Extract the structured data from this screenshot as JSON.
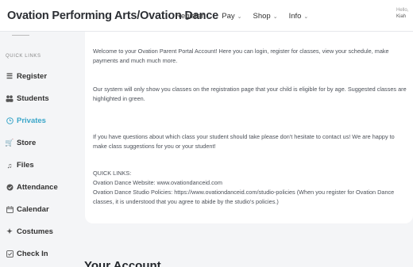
{
  "header": {
    "brand": "Ovation Performing Arts/Ovation Dance",
    "nav": [
      {
        "label": "Register",
        "icon": "chevron-down-icon"
      },
      {
        "label": "Pay",
        "icon": "chevron-down-icon"
      },
      {
        "label": "Shop",
        "icon": "chevron-down-icon"
      },
      {
        "label": "Info",
        "icon": "chevron-down-icon"
      }
    ],
    "user_greeting": "Hello,",
    "user_name": "Kiah"
  },
  "sidebar": {
    "section_label": "QUICK LINKS",
    "items": [
      {
        "label": "Register",
        "icon": "list-icon"
      },
      {
        "label": "Students",
        "icon": "users-icon"
      },
      {
        "label": "Privates",
        "icon": "clock-icon",
        "active": true
      },
      {
        "label": "Store",
        "icon": "cart-icon"
      },
      {
        "label": "Files",
        "icon": "music-icon"
      },
      {
        "label": "Attendance",
        "icon": "check-circle-icon"
      },
      {
        "label": "Calendar",
        "icon": "calendar-icon"
      },
      {
        "label": "Costumes",
        "icon": "person-icon"
      },
      {
        "label": "Check In",
        "icon": "checkbox-icon"
      }
    ]
  },
  "main": {
    "welcome": "Welcome to your Ovation Parent Portal Account! Here you can login, register for classes, view your schedule, make payments and much much more.",
    "system_note": "Our system will only show you classes on the registration page that your child is eligible for by age. Suggested classes are highlighted in green.",
    "questions": "If you have questions about which class your student should take please don't hesitate to contact us! We are happy to make class suggestions for you or your student!",
    "quick_links_title": "QUICK LINKS:",
    "website_line": "Ovation Dance Website: www.ovationdanceid.com",
    "policies_line": "Ovation Dance Studio Policies: https://www.ovationdanceid.com/studio-policies (When you register for Ovation Dance classes, it is understood that you agree to abide by the studio's policies.)",
    "account_heading": "Your Account"
  },
  "colors": {
    "accent": "#3aa6c9",
    "background": "#f4f5f7",
    "card": "#ffffff"
  }
}
